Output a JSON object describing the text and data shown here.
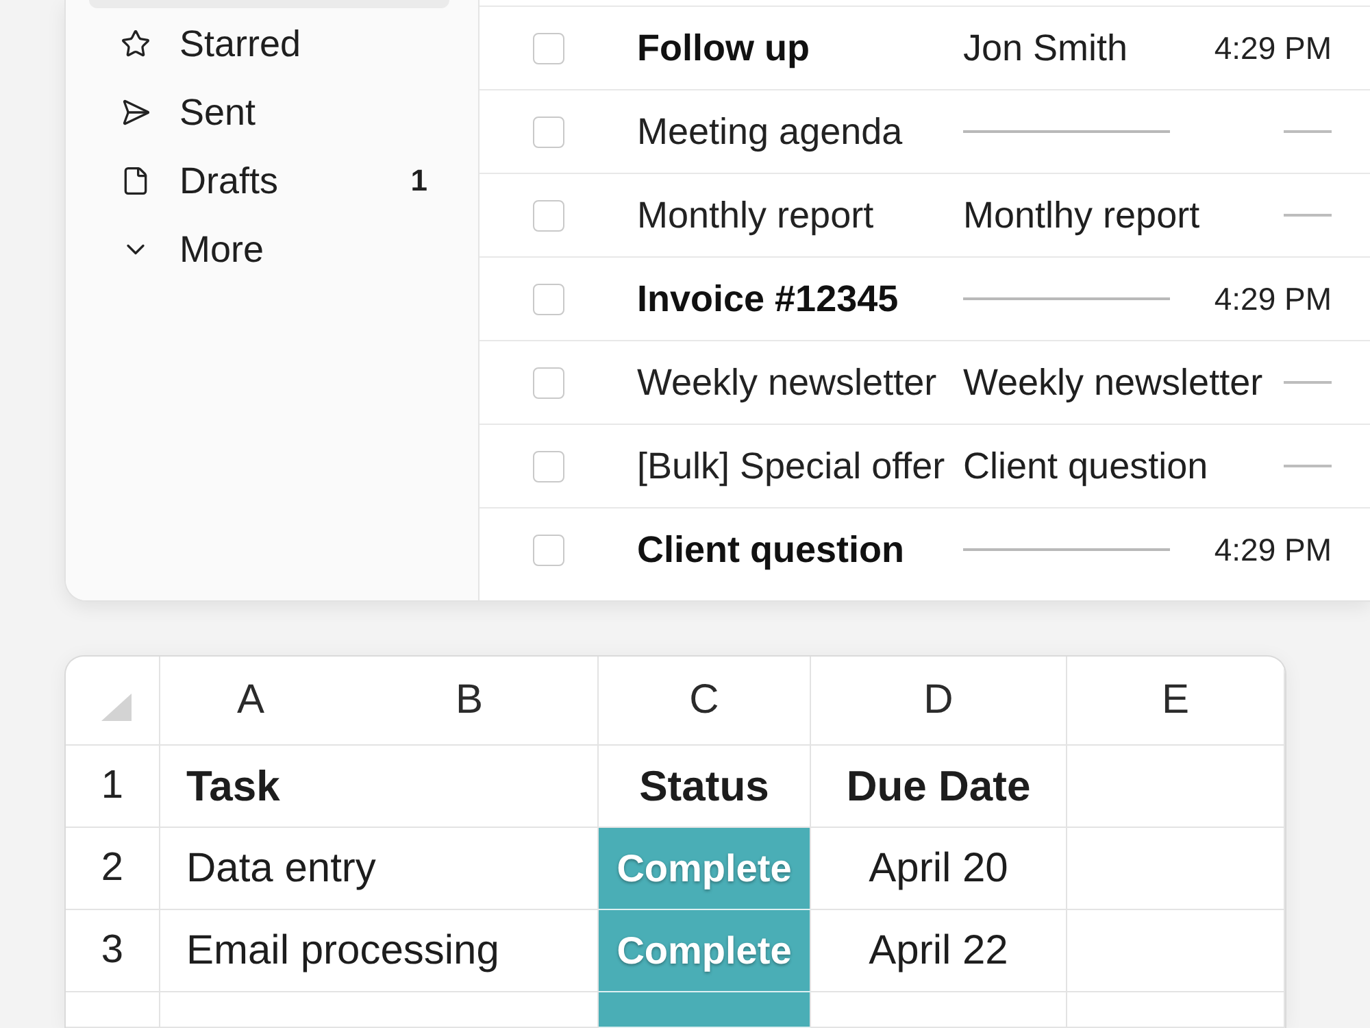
{
  "mail": {
    "sidebar": {
      "items": [
        {
          "kind": "cut_off",
          "selected": true
        },
        {
          "kind": "folder",
          "label": "Starred",
          "selected": false
        },
        {
          "kind": "folder",
          "label": "Sent",
          "selected": false
        },
        {
          "kind": "folder",
          "label": "Drafts",
          "count": "1",
          "selected": false
        },
        {
          "kind": "toggle",
          "label": "More",
          "selected": false,
          "expanded": false
        }
      ]
    },
    "messages": [
      {
        "checked": false,
        "unread": true,
        "subject": "Follow up",
        "sender": {
          "kind": "text",
          "text": "Jon Smith"
        },
        "time": {
          "kind": "text",
          "text": "4:29 PM"
        }
      },
      {
        "checked": false,
        "unread": false,
        "subject": "Meeting agenda",
        "sender": {
          "kind": "line"
        },
        "time": {
          "kind": "line"
        }
      },
      {
        "checked": false,
        "unread": false,
        "subject": "Monthly report",
        "sender": {
          "kind": "text",
          "text": "Montlhy report"
        },
        "time": {
          "kind": "line"
        }
      },
      {
        "checked": false,
        "unread": true,
        "subject": "Invoice #12345",
        "sender": {
          "kind": "line"
        },
        "time": {
          "kind": "text",
          "text": "4:29 PM"
        }
      },
      {
        "checked": false,
        "unread": false,
        "subject": "Weekly newsletter",
        "sender": {
          "kind": "text",
          "text": "Weekly newsletter"
        },
        "time": {
          "kind": "line"
        }
      },
      {
        "checked": false,
        "unread": false,
        "subject": "[Bulk] Special offer",
        "sender": {
          "kind": "text",
          "text": "Client question"
        },
        "time": {
          "kind": "line"
        }
      },
      {
        "checked": false,
        "unread": true,
        "subject": "Client question",
        "sender": {
          "kind": "line"
        },
        "time": {
          "kind": "text",
          "text": "4:29 PM"
        }
      }
    ]
  },
  "sheet": {
    "columns": [
      "A",
      "B",
      "C",
      "D",
      "E"
    ],
    "rows": [
      {
        "kind": "header",
        "number": "1",
        "task": "Task",
        "status": "Status",
        "status_highlighted": false,
        "due_date": "Due Date"
      },
      {
        "kind": "data",
        "number": "2",
        "task": "Data entry",
        "status": "Complete",
        "status_highlighted": true,
        "due_date": "April 20"
      },
      {
        "kind": "data",
        "number": "3",
        "task": "Email processing",
        "status": "Complete",
        "status_highlighted": true,
        "due_date": "April 22"
      },
      {
        "kind": "cut_off",
        "status_highlighted": true
      }
    ]
  }
}
